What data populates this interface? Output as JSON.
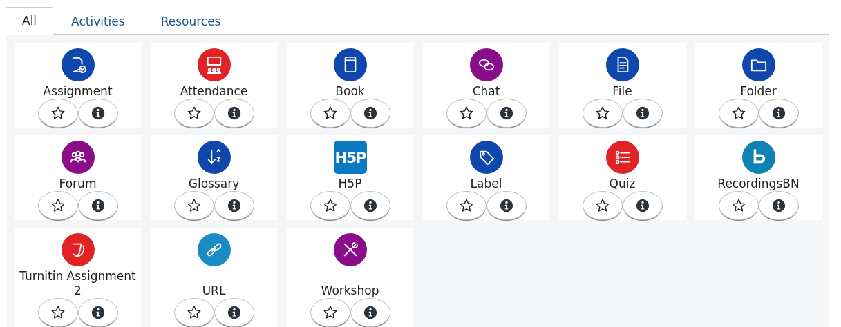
{
  "tabs": [
    {
      "label": "All",
      "selected": true
    },
    {
      "label": "Activities",
      "selected": false
    },
    {
      "label": "Resources",
      "selected": false
    }
  ],
  "modules": [
    {
      "name": "Assignment",
      "kind": "assignment",
      "color": "#0f47ad",
      "starred": false
    },
    {
      "name": "Attendance",
      "kind": "attendance",
      "color": "#e12325",
      "starred": false
    },
    {
      "name": "Book",
      "kind": "book",
      "color": "#0f47ad",
      "starred": false
    },
    {
      "name": "Chat",
      "kind": "chat",
      "color": "#8a0d8a",
      "starred": false
    },
    {
      "name": "File",
      "kind": "file",
      "color": "#0f47ad",
      "starred": false
    },
    {
      "name": "Folder",
      "kind": "folder",
      "color": "#0f47ad",
      "starred": false
    },
    {
      "name": "Forum",
      "kind": "forum",
      "color": "#8a0d8a",
      "starred": false
    },
    {
      "name": "Glossary",
      "kind": "glossary",
      "color": "#0f47ad",
      "starred": false
    },
    {
      "name": "H5P",
      "kind": "h5p",
      "color": "#0a78c2",
      "starred": false,
      "logo_text": "H5P"
    },
    {
      "name": "Label",
      "kind": "label",
      "color": "#0f47ad",
      "starred": false
    },
    {
      "name": "Quiz",
      "kind": "quiz",
      "color": "#e12325",
      "starred": false
    },
    {
      "name": "RecordingsBN",
      "kind": "recordings",
      "color": "#0e82b0",
      "starred": false
    },
    {
      "name": "Turnitin Assignment 2",
      "kind": "turnitin",
      "color": "#e12325",
      "starred": false
    },
    {
      "name": "URL",
      "kind": "url",
      "color": "#1a8bc5",
      "starred": false
    },
    {
      "name": "Workshop",
      "kind": "workshop",
      "color": "#8a0d8a",
      "starred": false
    }
  ]
}
